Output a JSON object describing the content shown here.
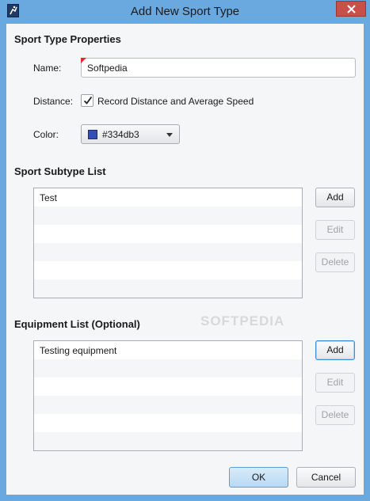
{
  "window": {
    "title": "Add New Sport Type",
    "app_icon": "sport-app-icon",
    "close_icon": "close-icon"
  },
  "properties": {
    "section_title": "Sport Type Properties",
    "name_label": "Name:",
    "name_value": "Softpedia",
    "distance_label": "Distance:",
    "distance_checked": true,
    "distance_option_label": "Record Distance and Average Speed",
    "color_label": "Color:",
    "color_value": "#334db3",
    "color_swatch": "#334db3"
  },
  "subtypes": {
    "section_title": "Sport Subtype List",
    "items": [
      "Test"
    ],
    "add_label": "Add",
    "edit_label": "Edit",
    "delete_label": "Delete"
  },
  "equipment": {
    "section_title": "Equipment List (Optional)",
    "items": [
      "Testing equipment"
    ],
    "add_label": "Add",
    "edit_label": "Edit",
    "delete_label": "Delete"
  },
  "watermark": "SOFTPEDIA",
  "footer": {
    "ok_label": "OK",
    "cancel_label": "Cancel"
  }
}
